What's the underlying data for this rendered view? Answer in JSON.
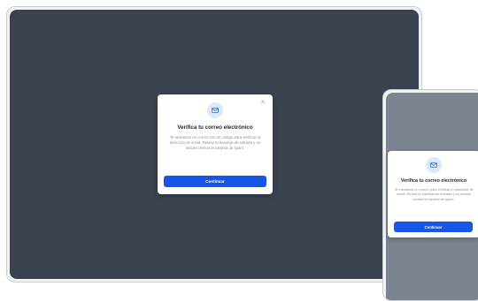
{
  "dialog": {
    "title": "Verifica tu correo electrónico",
    "body_desktop": "Te enviamos un correo con un código para verificar tu dirección de email. Revisa tu bandeja de entrada y no olvides revisar la carpeta de spam.",
    "body_mobile": "Te enviamos un correo para verificar tu dirección de email. Revisa tu bandeja de entrada y no olvides revisar la carpeta de spam.",
    "button_label": "Continuar",
    "close_glyph": "×",
    "icon": "mail-icon"
  },
  "colors": {
    "desktop_backdrop": "#3b4250",
    "mobile_backdrop": "#7c8391",
    "primary": "#1756e8",
    "icon_badge": "#dce9fb"
  }
}
